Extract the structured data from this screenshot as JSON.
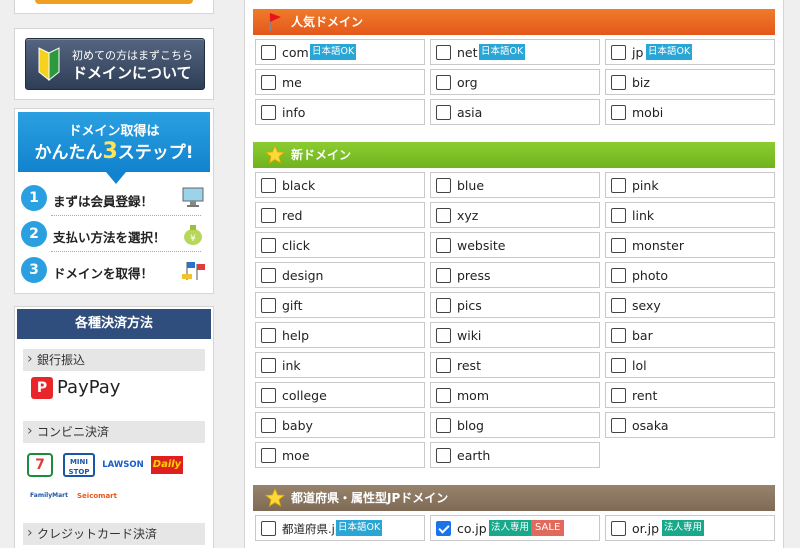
{
  "sidebar": {
    "beginner": {
      "line1": "初めての方はまずこちら",
      "line2": "ドメインについて"
    },
    "steps": {
      "title1": "ドメイン取得は",
      "title2_a": "かんたん",
      "title2_b": "3",
      "title2_c": "ステップ!",
      "items": [
        {
          "num": "1",
          "label": "まずは会員登録！",
          "icon": "monitor-icon"
        },
        {
          "num": "2",
          "label": "支払い方法を選択！",
          "icon": "money-bag-icon"
        },
        {
          "num": "3",
          "label": "ドメインを取得！",
          "icon": "flags-icon"
        }
      ]
    },
    "payment": {
      "title": "各種決済方法",
      "categories": [
        "銀行振込",
        "コンビニ決済",
        "クレジットカード決済"
      ],
      "paypay": "PayPay",
      "stores": [
        "7",
        "MINI STOP",
        "LAWSON",
        "Daily",
        "FamilyMart",
        "Seicomart"
      ]
    }
  },
  "sections": [
    {
      "title": "人気ドメイン",
      "icon": "flag-icon",
      "color": "#e86424",
      "rows": [
        [
          {
            "name": "com",
            "tag": "日本語OK"
          },
          {
            "name": "net",
            "tag": "日本語OK"
          },
          {
            "name": "jp",
            "tag": "日本語OK"
          }
        ],
        [
          {
            "name": "me"
          },
          {
            "name": "org"
          },
          {
            "name": "biz"
          }
        ],
        [
          {
            "name": "info"
          },
          {
            "name": "asia"
          },
          {
            "name": "mobi"
          }
        ]
      ]
    },
    {
      "title": "新ドメイン",
      "icon": "star-icon",
      "color": "#7fbf26",
      "rows": [
        [
          {
            "name": "black"
          },
          {
            "name": "blue"
          },
          {
            "name": "pink"
          }
        ],
        [
          {
            "name": "red"
          },
          {
            "name": "xyz"
          },
          {
            "name": "link"
          }
        ],
        [
          {
            "name": "click"
          },
          {
            "name": "website"
          },
          {
            "name": "monster"
          }
        ],
        [
          {
            "name": "design"
          },
          {
            "name": "press"
          },
          {
            "name": "photo"
          }
        ],
        [
          {
            "name": "gift"
          },
          {
            "name": "pics"
          },
          {
            "name": "sexy"
          }
        ],
        [
          {
            "name": "help"
          },
          {
            "name": "wiki"
          },
          {
            "name": "bar"
          }
        ],
        [
          {
            "name": "ink"
          },
          {
            "name": "rest"
          },
          {
            "name": "lol"
          }
        ],
        [
          {
            "name": "college"
          },
          {
            "name": "mom"
          },
          {
            "name": "rent"
          }
        ],
        [
          {
            "name": "baby"
          },
          {
            "name": "blog"
          },
          {
            "name": "osaka"
          }
        ],
        [
          {
            "name": "moe"
          },
          {
            "name": "earth"
          }
        ]
      ]
    },
    {
      "title": "都道府県・属性型JPドメイン",
      "icon": "star-icon",
      "color": "#8a7660",
      "rows": [
        [
          {
            "name": "都道府県.jp",
            "tag": "日本語OK"
          },
          {
            "name": "co.jp",
            "tag": "法人専用",
            "tag2": "SALE",
            "checked": true
          },
          {
            "name": "or.jp",
            "tag": "法人専用"
          }
        ]
      ]
    }
  ]
}
